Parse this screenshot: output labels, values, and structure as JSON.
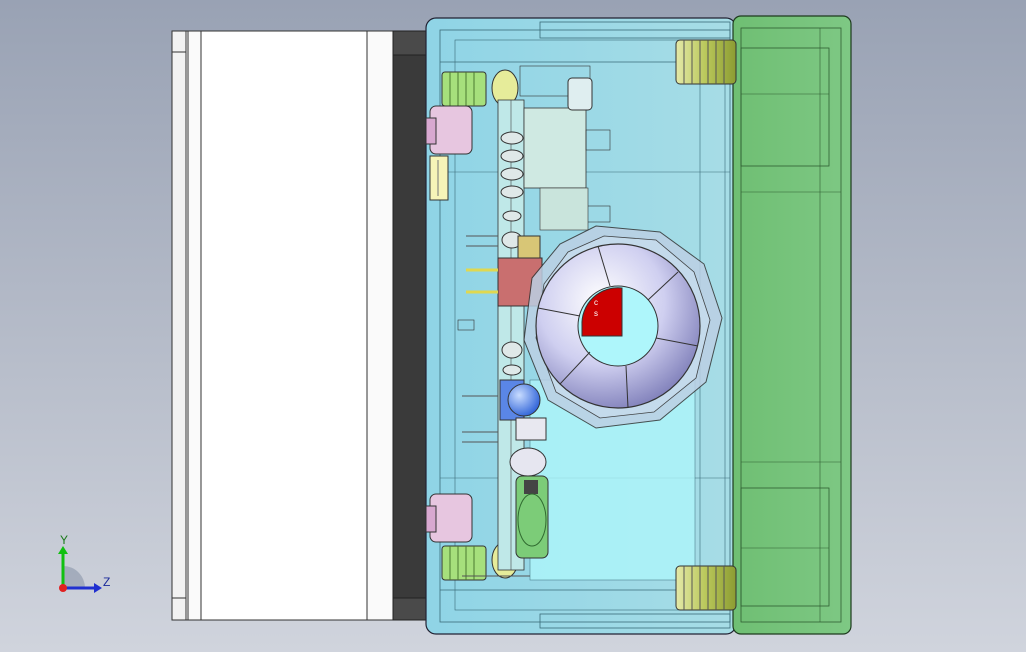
{
  "viewport": {
    "background_top": "#99a2b4",
    "background_bottom": "#d0d4dd"
  },
  "model": {
    "housing_color": "#9fe0ee",
    "cover_color": "#74c27a",
    "bracket_color": "#ffffff",
    "backplate_color": "#3a3a3a",
    "toroid_color": "#d8d8f4",
    "core_marker_color": "#cc0000",
    "led_color": "#3f7ff0",
    "connector_color": "#e7c6e0",
    "gear_color": "#c8d86a"
  },
  "triad": {
    "x_axis_color": "#e02020",
    "y_axis_color": "#10c010",
    "z_axis_color": "#2030d0",
    "y_label": "Y",
    "z_label": "Z"
  }
}
